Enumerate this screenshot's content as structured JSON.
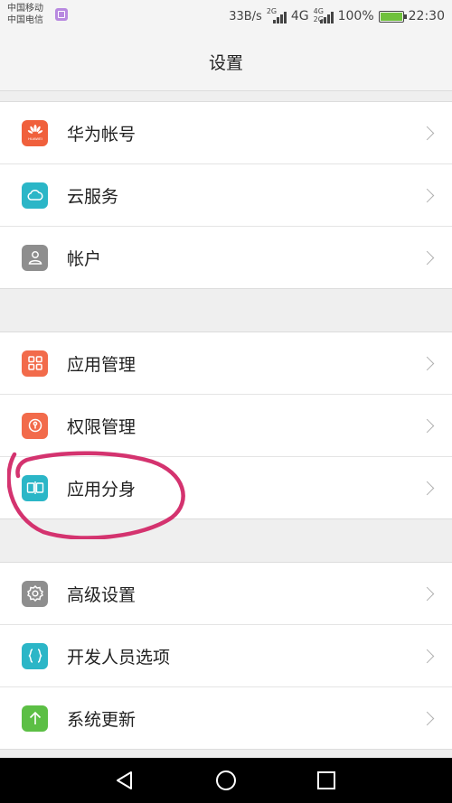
{
  "status_bar": {
    "carrier1": "中国移动",
    "carrier2": "中国电信",
    "net_speed": "33B/s",
    "net1": "2G",
    "net2": "4G",
    "net3": "4G 2G",
    "battery": "100%",
    "time": "22:30"
  },
  "header": {
    "title": "设置"
  },
  "groups": [
    {
      "items": [
        {
          "label": "华为帐号",
          "icon": "huawei-logo-icon",
          "color": "#f0603c"
        },
        {
          "label": "云服务",
          "icon": "cloud-icon",
          "color": "#2bb6c7"
        },
        {
          "label": "帐户",
          "icon": "person-icon",
          "color": "#8e8e8e"
        }
      ]
    },
    {
      "items": [
        {
          "label": "应用管理",
          "icon": "grid-icon",
          "color": "#f26b4b"
        },
        {
          "label": "权限管理",
          "icon": "key-icon",
          "color": "#f26b4b"
        },
        {
          "label": "应用分身",
          "icon": "twin-app-icon",
          "color": "#2bb6c7"
        }
      ]
    },
    {
      "items": [
        {
          "label": "高级设置",
          "icon": "gear-icon",
          "color": "#8e8e8e"
        },
        {
          "label": "开发人员选项",
          "icon": "braces-icon",
          "color": "#2bb6c7"
        },
        {
          "label": "系统更新",
          "icon": "up-arrow-icon",
          "color": "#5cbf45"
        }
      ]
    }
  ],
  "huawei_logo_text": "HUAWEI",
  "annotation_color": "#d4336f"
}
